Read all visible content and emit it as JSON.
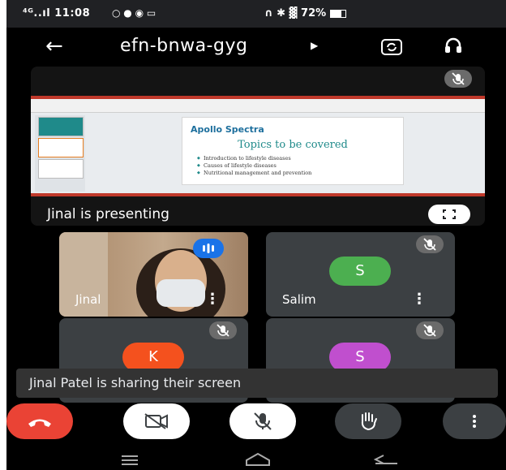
{
  "status_bar": {
    "left": "⁴ᴳ..ıl 11:08",
    "right": "72%"
  },
  "header": {
    "meeting_code": "efn-bnwa-gyg"
  },
  "presentation": {
    "label": "Jinal is presenting",
    "slide": {
      "brand": "Apollo Spectra",
      "title": "Topics to be covered",
      "bullets": [
        "Introduction to lifestyle diseases",
        "Causes of lifestyle diseases",
        "Nutritional management and prevention"
      ]
    }
  },
  "participants": [
    {
      "name": "Jinal"
    },
    {
      "name": "Salim",
      "initial": "S"
    },
    {
      "name": "",
      "initial": "K"
    },
    {
      "name": "",
      "initial": "S"
    }
  ],
  "snackbar": {
    "message": "Jinal Patel is sharing their screen"
  },
  "colors": {
    "end_call": "#ea4335",
    "salim": "#4caf50",
    "k": "#f4511e",
    "s2": "#c04fce",
    "speaking": "#1a73e8"
  }
}
